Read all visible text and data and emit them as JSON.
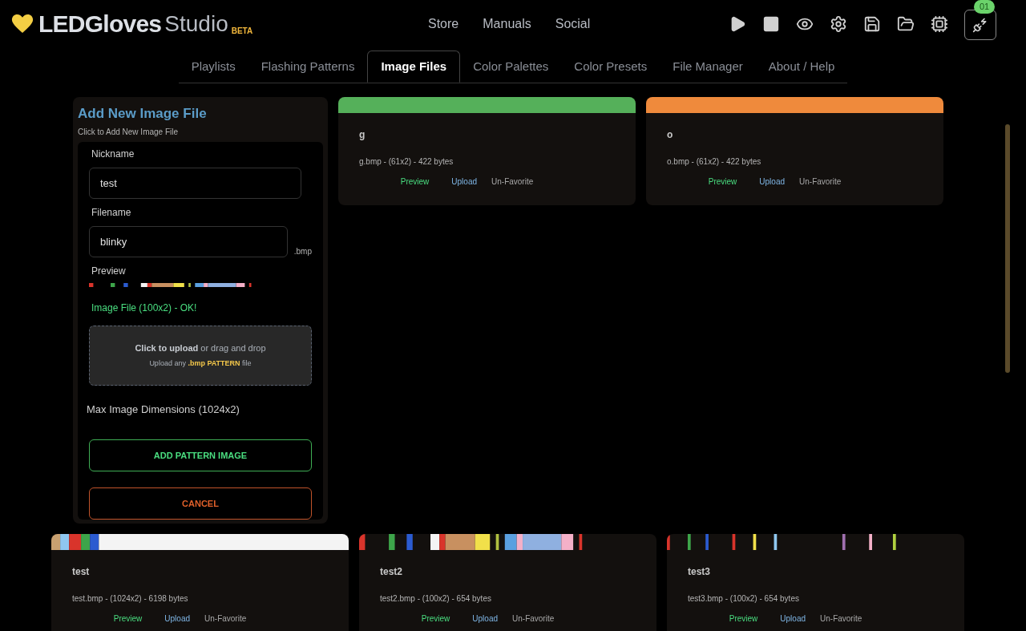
{
  "logo": {
    "name": "LEDGloves",
    "suffix": "Studio",
    "badge": "BETA"
  },
  "nav": [
    "Store",
    "Manuals",
    "Social"
  ],
  "toolbar": {
    "device_badge": "01"
  },
  "tabs": [
    {
      "label": "Playlists",
      "selected": false
    },
    {
      "label": "Flashing Patterns",
      "selected": false
    },
    {
      "label": "Image Files",
      "selected": true
    },
    {
      "label": "Color Palettes",
      "selected": false
    },
    {
      "label": "Color Presets",
      "selected": false
    },
    {
      "label": "File Manager",
      "selected": false
    },
    {
      "label": "About / Help",
      "selected": false
    }
  ],
  "form": {
    "title": "Add New Image File",
    "subtitle": "Click to Add New Image File",
    "nickname_label": "Nickname",
    "nickname": "test",
    "filename_label": "Filename",
    "filename": "blinky",
    "extension": ".bmp",
    "preview_label": "Preview",
    "status": "Image File (100x2) - OK!",
    "upload_line1": "**Click to upload** or drag and drop",
    "upload_line2": "Upload any **.bmp PATTERN** file",
    "max_dims": "Max Image Dimensions (1024x2)",
    "add_button": "ADD PATTERN IMAGE",
    "cancel_button": "CANCEL"
  },
  "cards": [
    {
      "banner": {
        "kind": "color",
        "color": "#55b05a"
      },
      "name": "g",
      "info": "g.bmp - (61x2) - 422 bytes",
      "actions": [
        "Preview",
        "Upload",
        "Un-Favorite"
      ]
    },
    {
      "banner": {
        "kind": "color",
        "color": "#ef8a3c"
      },
      "name": "o",
      "info": "o.bmp - (61x2) - 422 bytes",
      "actions": [
        "Preview",
        "Upload",
        "Un-Favorite"
      ]
    },
    {
      "banner": {
        "kind": "pattern"
      },
      "name": "test",
      "info": "test.bmp - (1024x2) - 6198 bytes",
      "actions": [
        "Preview",
        "Upload",
        "Un-Favorite"
      ]
    },
    {
      "banner": {
        "kind": "pattern"
      },
      "name": "test2",
      "info": "test2.bmp - (100x2) - 654 bytes",
      "actions": [
        "Preview",
        "Upload",
        "Un-Favorite"
      ]
    },
    {
      "banner": {
        "kind": "pattern"
      },
      "name": "test3",
      "info": "test3.bmp - (100x2) - 654 bytes",
      "actions": [
        "Preview",
        "Upload",
        "Un-Favorite"
      ]
    }
  ]
}
